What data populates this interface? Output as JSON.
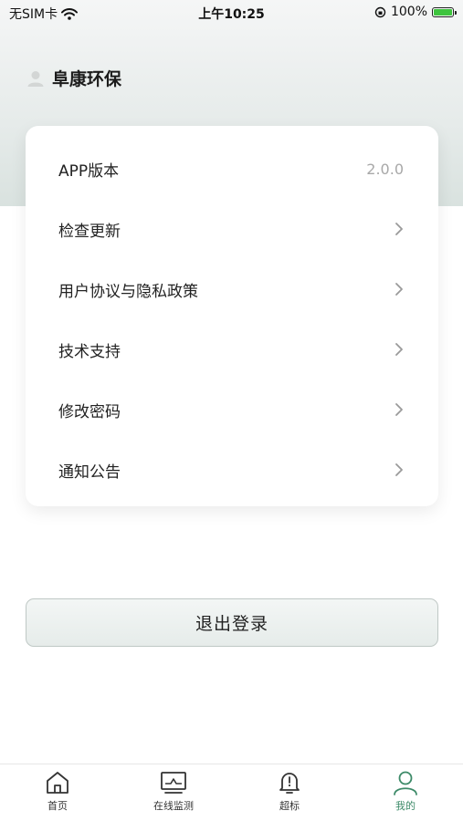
{
  "status_bar": {
    "carrier": "无SIM卡",
    "time": "上午10:25",
    "battery": "100%"
  },
  "user": {
    "name": "阜康环保"
  },
  "settings": [
    {
      "label": "APP版本",
      "value": "2.0.0"
    },
    {
      "label": "检查更新"
    },
    {
      "label": "用户协议与隐私政策"
    },
    {
      "label": "技术支持"
    },
    {
      "label": "修改密码"
    },
    {
      "label": "通知公告"
    }
  ],
  "logout_label": "退出登录",
  "tabbar": {
    "tabs": [
      {
        "label": "首页",
        "icon": "home-icon"
      },
      {
        "label": "在线监测",
        "icon": "monitor-icon"
      },
      {
        "label": "超标",
        "icon": "bell-alert-icon"
      },
      {
        "label": "我的",
        "icon": "person-icon",
        "active": true
      }
    ],
    "active_color": "#3c8a68"
  }
}
